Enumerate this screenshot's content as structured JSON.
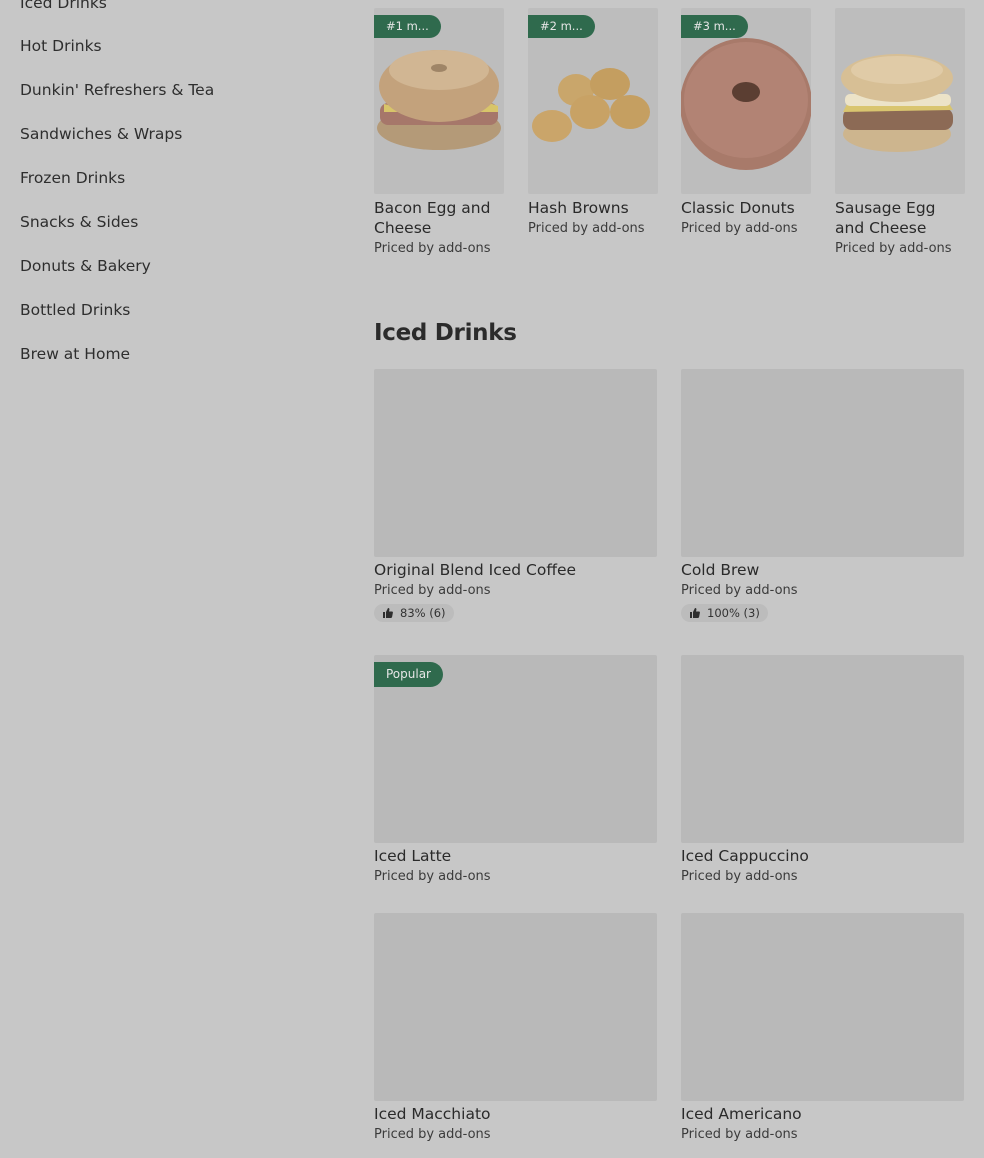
{
  "sidebar": {
    "items": [
      {
        "label": "Iced Drinks"
      },
      {
        "label": "Hot Drinks"
      },
      {
        "label": "Dunkin' Refreshers & Tea"
      },
      {
        "label": "Sandwiches & Wraps"
      },
      {
        "label": "Frozen Drinks"
      },
      {
        "label": "Snacks & Sides"
      },
      {
        "label": "Donuts & Bakery"
      },
      {
        "label": "Bottled Drinks"
      },
      {
        "label": "Brew at Home"
      }
    ]
  },
  "most_ordered": {
    "items": [
      {
        "badge": "#1 m...",
        "name": "Bacon Egg and Cheese",
        "price": "Priced by add-ons"
      },
      {
        "badge": "#2 m...",
        "name": "Hash Browns",
        "price": "Priced by add-ons"
      },
      {
        "badge": "#3 m...",
        "name": "Classic Donuts",
        "price": "Priced by add-ons"
      },
      {
        "badge": "",
        "name": "Sausage Egg and Cheese",
        "price": "Priced by add-ons"
      }
    ]
  },
  "iced_drinks": {
    "title": "Iced Drinks",
    "items": [
      {
        "name": "Original Blend Iced Coffee",
        "price": "Priced by add-ons",
        "rating": "83% (6)"
      },
      {
        "name": "Cold Brew",
        "price": "Priced by add-ons",
        "rating": "100% (3)"
      },
      {
        "name": "Iced Latte",
        "price": "Priced by add-ons",
        "badge": "Popular"
      },
      {
        "name": "Iced Cappuccino",
        "price": "Priced by add-ons"
      },
      {
        "name": "Iced Macchiato",
        "price": "Priced by add-ons"
      },
      {
        "name": "Iced Americano",
        "price": "Priced by add-ons"
      }
    ]
  },
  "colors": {
    "accent": "#2f6a4d",
    "background": "#c7c7c7"
  }
}
